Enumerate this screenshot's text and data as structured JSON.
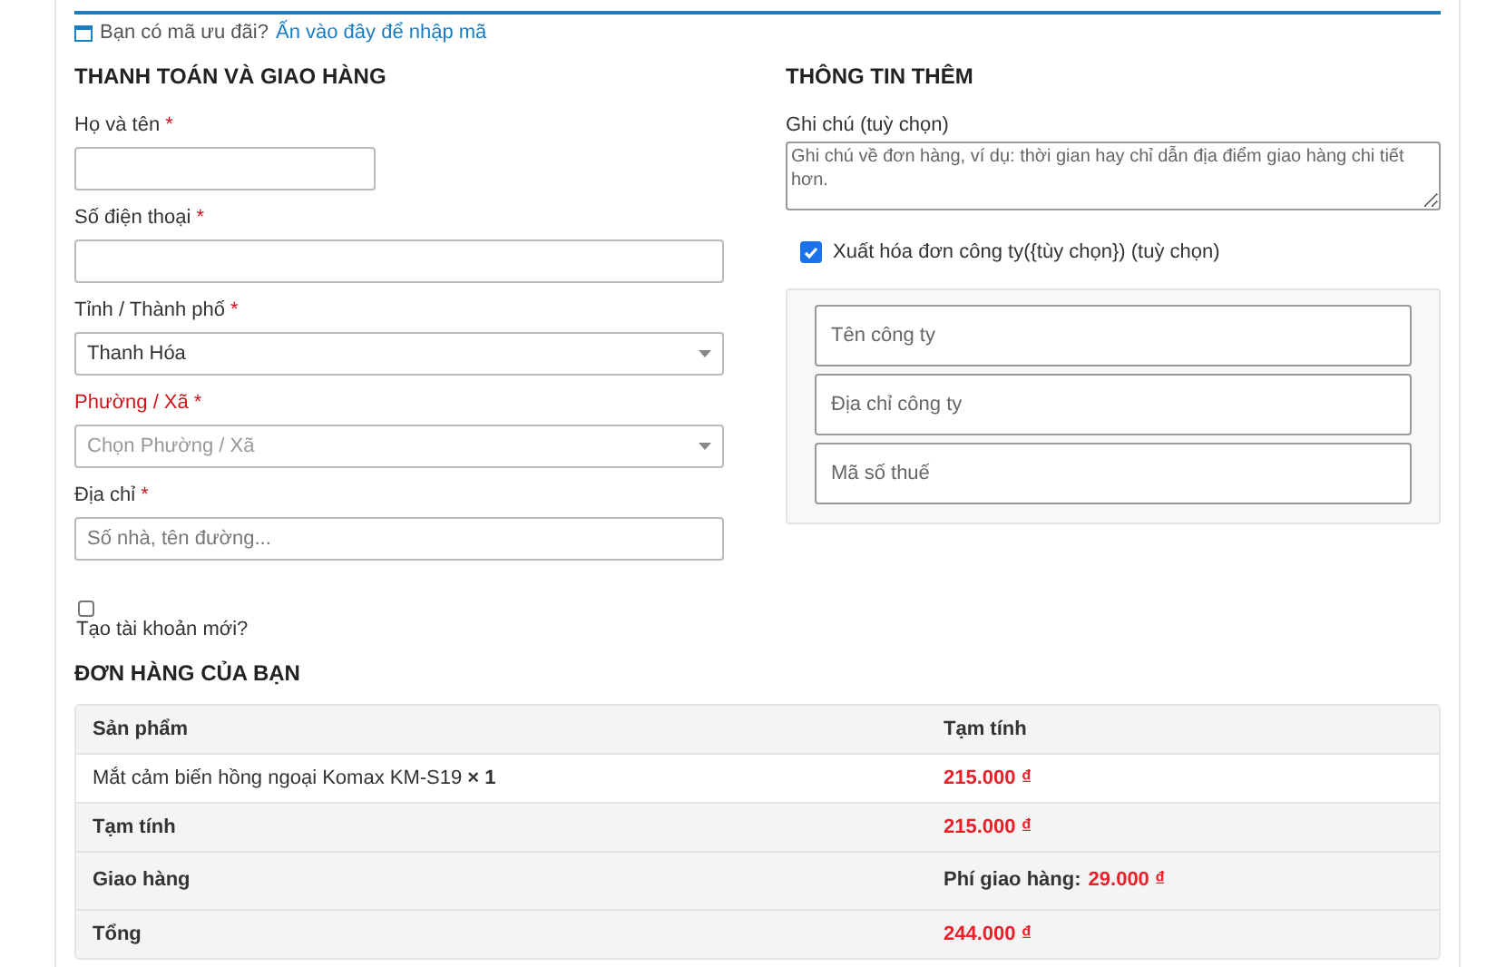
{
  "coupon": {
    "text": "Bạn có mã ưu đãi?",
    "link": "Ấn vào đây để nhập mã"
  },
  "billing": {
    "title": "THANH TOÁN VÀ GIAO HÀNG",
    "fields": [
      {
        "kind": "short_text",
        "label": "Họ và tên",
        "required_mark": "*",
        "invalid": false
      },
      {
        "kind": "text",
        "label": "Số điện thoại",
        "required_mark": "*",
        "invalid": false
      },
      {
        "kind": "select",
        "label": "Tỉnh / Thành phố",
        "required_mark": "*",
        "invalid": false,
        "value": "Thanh Hóa"
      },
      {
        "kind": "select",
        "label": "Phường / Xã",
        "required_mark": "*",
        "invalid": true,
        "placeholder": "Chọn Phường / Xã"
      },
      {
        "kind": "text",
        "label": "Địa chỉ",
        "required_mark": "*",
        "invalid": false,
        "placeholder": "Số nhà, tên đường..."
      }
    ]
  },
  "create_account": {
    "label": "Tạo tài khoản mới?",
    "checked": false
  },
  "additional": {
    "title": "THÔNG TIN THÊM",
    "notes": {
      "label": "Ghi chú (tuỳ chọn)",
      "placeholder": "Ghi chú về đơn hàng, ví dụ: thời gian hay chỉ dẫn địa điểm giao hàng chi tiết hơn."
    },
    "invoice": {
      "label": "Xuất hóa đơn công ty({tùy chọn}) (tuỳ chọn)",
      "checked": true
    },
    "invoice_fields": [
      {
        "placeholder": "Tên công ty"
      },
      {
        "placeholder": "Địa chỉ công ty"
      },
      {
        "placeholder": "Mã số thuế"
      }
    ]
  },
  "order": {
    "title": "ĐƠN HÀNG CỦA BẠN",
    "columns": [
      "Sản phẩm",
      "Tạm tính"
    ],
    "items": [
      {
        "product": "Mắt cảm biến hồng ngoại Komax KM-S19",
        "qty": "× 1",
        "total": "215.000 ₫"
      }
    ],
    "totals": [
      {
        "label": "Tạm tính",
        "value": "215.000 ₫"
      },
      {
        "label": "Giao hàng",
        "prefix": "Phí giao hàng:",
        "value": "29.000 ₫"
      },
      {
        "label": "Tổng",
        "value": "244.000 ₫"
      }
    ]
  }
}
